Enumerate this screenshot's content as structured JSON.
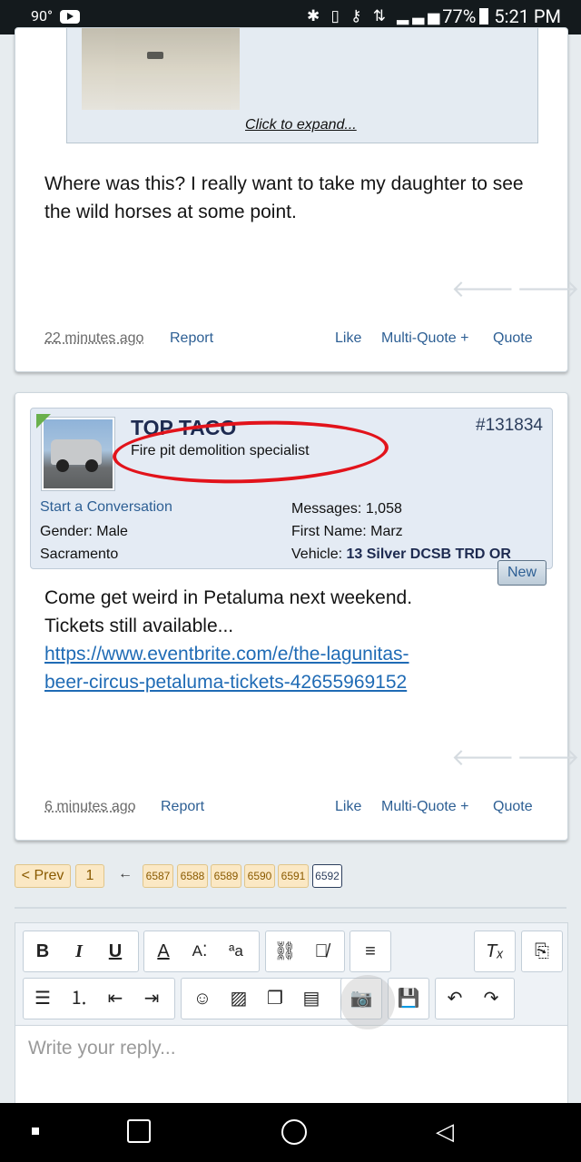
{
  "status_bar": {
    "temperature": "90°",
    "battery": "77%",
    "time": "5:21 PM",
    "icons": "✱ ▯ ⚷ ⇅ ▂▃▅"
  },
  "post1": {
    "quote_expand": "Click to expand...",
    "message": "Where was this? I really want to take my daughter to see the wild horses at some point.",
    "time_ago": "22 minutes ago",
    "report": "Report",
    "like": "Like",
    "multi_quote": "Multi-Quote +",
    "quote": "Quote"
  },
  "post2": {
    "username": "TOP TACO",
    "user_title": "Fire pit demolition specialist",
    "post_number": "#131834",
    "start_conversation": "Start a Conversation",
    "gender_label": "Gender:",
    "gender": "Male",
    "location": "Sacramento",
    "messages_label": "Messages:",
    "messages": "1,058",
    "first_name_label": "First Name:",
    "first_name": "Marz",
    "vehicle_label": "Vehicle:",
    "vehicle": "13 Silver DCSB TRD OR",
    "new_badge": "New",
    "message_line1": "Come get weird in Petaluma next weekend.",
    "message_line2": "Tickets still available...",
    "link_line1": "https://www.eventbrite.com/e/the-lagunitas-",
    "link_line2": "beer-circus-petaluma-tickets-42655969152",
    "time_ago": "6 minutes ago",
    "report": "Report",
    "like": "Like",
    "multi_quote": "Multi-Quote +",
    "quote": "Quote"
  },
  "pagination": {
    "prev": "< Prev",
    "first": "1",
    "arrow": "←",
    "pages": [
      "6587",
      "6588",
      "6589",
      "6590",
      "6591",
      "6592"
    ],
    "current": "6592"
  },
  "editor": {
    "placeholder": "Write your reply..."
  },
  "colors": {
    "accent": "#2d5f94",
    "link": "#1f6bb5",
    "highlight_circle": "#e2131b"
  }
}
